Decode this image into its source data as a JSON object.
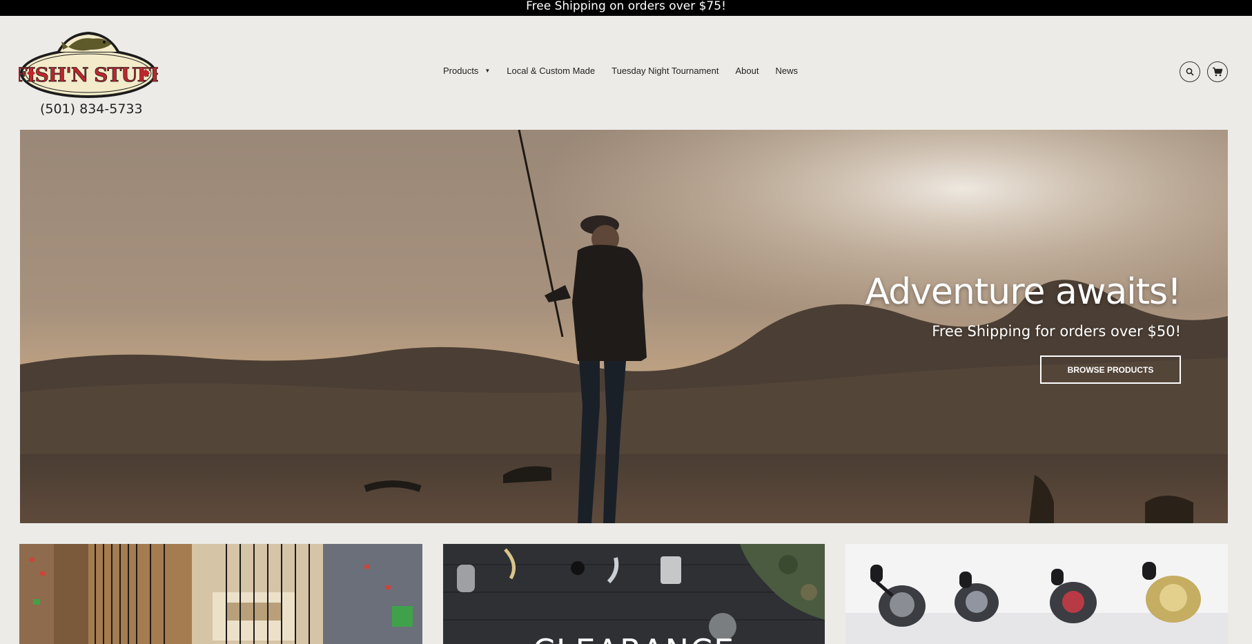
{
  "announcement": "Free Shipping on orders over $75!",
  "brand": {
    "logo_text": "FISH'N STUFF",
    "phone": "(501) 834-5733"
  },
  "nav": {
    "items": [
      {
        "label": "Products",
        "has_dropdown": true
      },
      {
        "label": "Local & Custom Made"
      },
      {
        "label": "Tuesday Night Tournament"
      },
      {
        "label": "About"
      },
      {
        "label": "News"
      }
    ]
  },
  "header_icons": [
    "search-icon",
    "cart-icon"
  ],
  "hero": {
    "title": "Adventure awaits!",
    "subtitle": "Free Shipping for orders over $50!",
    "button_label": "BROWSE PRODUCTS"
  },
  "tiles": [
    {
      "name": "rods"
    },
    {
      "name": "clearance",
      "label": "CLEARANCE"
    },
    {
      "name": "reels"
    }
  ],
  "colors": {
    "announcement_bg": "#000000",
    "page_bg": "#ecebe8",
    "logo_red": "#c0262d"
  }
}
